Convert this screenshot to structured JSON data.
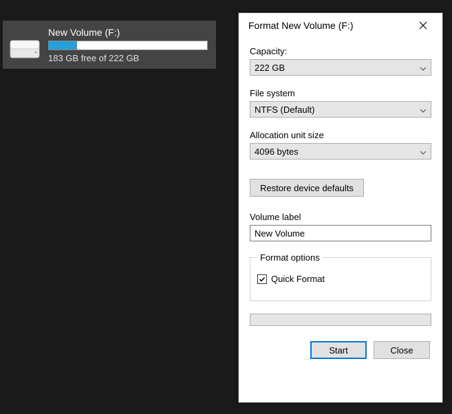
{
  "drive": {
    "name": "New Volume (F:)",
    "free_text": "183 GB free of 222 GB"
  },
  "dialog": {
    "title": "Format New Volume (F:)",
    "capacity_label": "Capacity:",
    "capacity_value": "222 GB",
    "fs_label": "File system",
    "fs_value": "NTFS (Default)",
    "alloc_label": "Allocation unit size",
    "alloc_value": "4096 bytes",
    "restore_label": "Restore device defaults",
    "vol_label": "Volume label",
    "vol_value": "New Volume",
    "fmt_legend": "Format options",
    "quick_label": "Quick Format",
    "start_label": "Start",
    "close_label": "Close"
  }
}
